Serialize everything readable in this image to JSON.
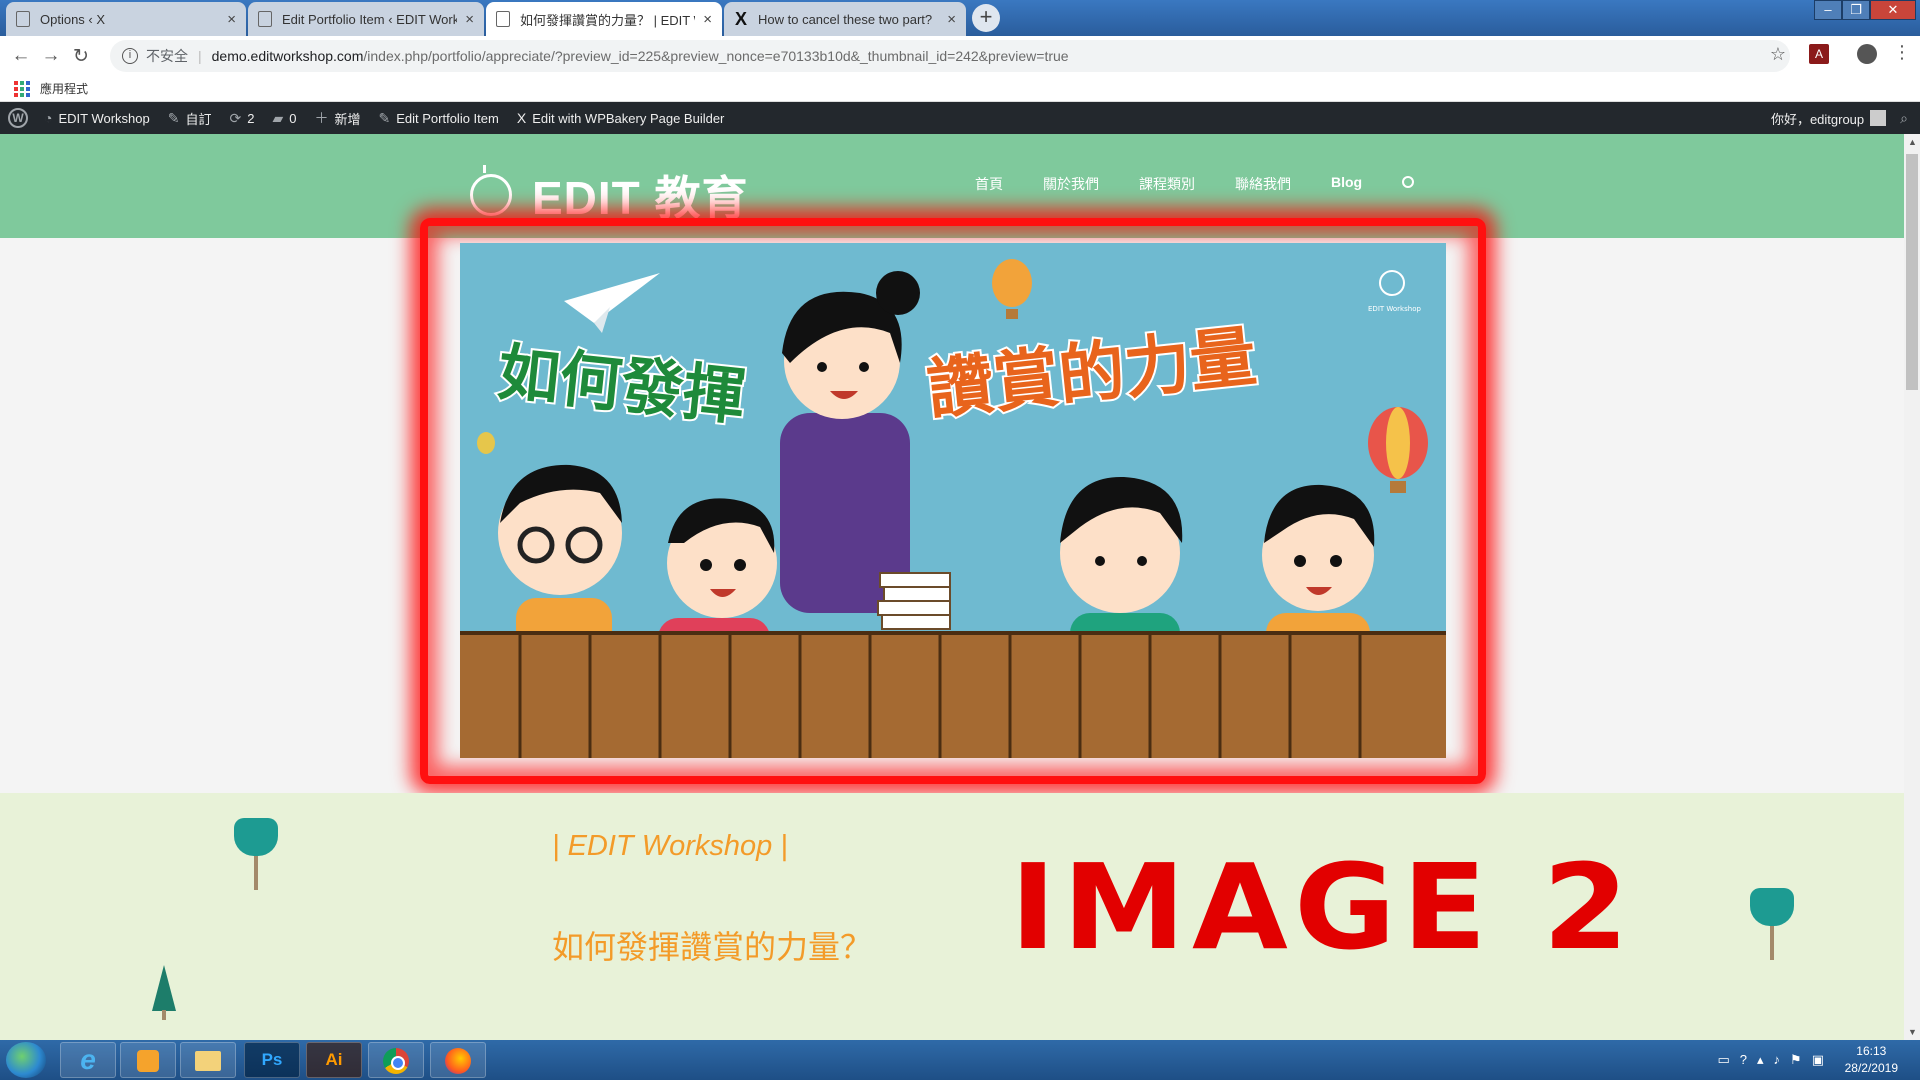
{
  "browser": {
    "tabs": [
      {
        "title": "Options ‹ X",
        "icon": "page-icon",
        "active": false
      },
      {
        "title": "Edit Portfolio Item ‹ EDIT Workshop",
        "icon": "page-icon",
        "active": false
      },
      {
        "title": "如何發揮讚賞的力量？ | EDIT Workshop",
        "icon": "page-icon",
        "active": true
      },
      {
        "title": "How to cancel these two part?",
        "icon": "x-brand-icon",
        "active": false
      }
    ],
    "new_tab": "+",
    "close_glyph": "×",
    "window_controls": {
      "minimize": "–",
      "maximize": "❐",
      "close": "✕"
    },
    "address": {
      "security_label": "不安全",
      "host": "demo.editworkshop.com",
      "path": "/index.php/portfolio/appreciate/?preview_id=225&preview_nonce=e70133b10d&_thumbnail_id=242&preview=true"
    },
    "bookmarks_label": "應用程式"
  },
  "admin_bar": {
    "site_name": "EDIT Workshop",
    "customize": "自訂",
    "updates_count": "2",
    "comments_count": "0",
    "new_label": "新增",
    "edit_item": "Edit Portfolio Item",
    "wpbakery": "Edit with WPBakery Page Builder",
    "wpbakery_icon": "X",
    "greeting": "你好，editgroup"
  },
  "site": {
    "logo_text": "EDIT 教育",
    "menu": [
      "首頁",
      "關於我們",
      "課程類別",
      "聯絡我們",
      "Blog"
    ]
  },
  "banner": {
    "text_left": "如何發揮",
    "text_right": "讚賞的力量",
    "logo_small": "EDIT Workshop"
  },
  "content": {
    "workshop_title": "| EDIT Workshop |",
    "subtitle": "如何發揮讚賞的力量？",
    "annotation": "IMAGE 2"
  },
  "taskbar": {
    "apps": [
      "ie",
      "media",
      "explorer",
      "photoshop",
      "illustrator",
      "chrome",
      "firefox"
    ],
    "ps_label": "Ps",
    "ai_label": "Ai",
    "time": "16:13",
    "date": "28/2/2019"
  },
  "colors": {
    "header_green": "#7fc99c",
    "adminbar": "#23282d",
    "accent_orange": "#f39b29",
    "annotation_red": "#e20000",
    "content_bg": "#e8f2d8"
  }
}
